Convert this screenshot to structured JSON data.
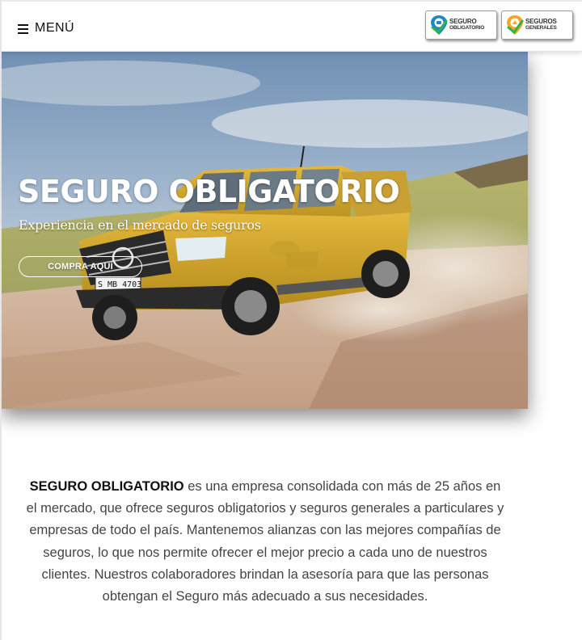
{
  "header": {
    "menu_label": "MENÚ",
    "brands": [
      {
        "line1": "SEGURO",
        "line2": "OBLIGATORIO",
        "logo_color": "#1e88c7",
        "check_color": "#2fb34a"
      },
      {
        "line1": "SEGUROS",
        "line2": "GENERALES",
        "logo_color": "#f5a623",
        "check_color": "#2fb34a"
      }
    ]
  },
  "hero": {
    "title": "SEGURO OBLIGATORIO",
    "subtitle": "Experiencia en el mercado de seguros",
    "cta_label": "COMPRA AQUÍ",
    "plate": "S MB 4703",
    "truck_color": "#d4a62a"
  },
  "about": {
    "lead": "SEGURO OBLIGATORIO",
    "body": " es una empresa consolidada con más de 25 años en el mercado, que ofrece seguros obligatorios y seguros generales a particulares y empresas de todo el país. Mantenemos alianzas con las mejores compañías de seguros, lo que nos permite ofrecer el mejor precio a cada uno de nuestros clientes. Nuestros colaboradores brindan la asesoría para que las personas obtengan el Seguro más adecuado a sus necesidades."
  }
}
